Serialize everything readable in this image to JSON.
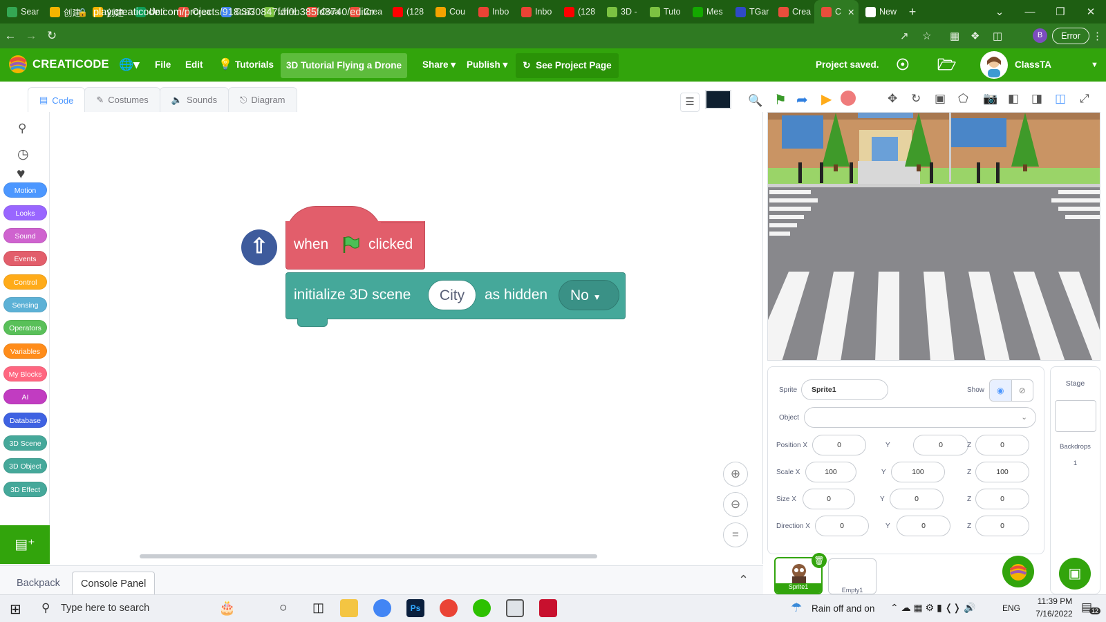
{
  "browser": {
    "tabs": [
      {
        "label": "Sear",
        "color": "#34a853"
      },
      {
        "label": "创建",
        "color": "#f4b400"
      },
      {
        "label": "创建",
        "color": "#f4b400"
      },
      {
        "label": "Unti",
        "color": "#0f9d58"
      },
      {
        "label": "Crea",
        "color": "#e94e3c"
      },
      {
        "label": "CST/",
        "color": "#4285f4"
      },
      {
        "label": "Unre",
        "color": "#7cc242"
      },
      {
        "label": "Crea",
        "color": "#e94e3c"
      },
      {
        "label": "Crea",
        "color": "#e94e3c"
      },
      {
        "label": "(128",
        "color": "#ff0000"
      },
      {
        "label": "Cou",
        "color": "#f4a300"
      },
      {
        "label": "Inbo",
        "color": "#ea4335"
      },
      {
        "label": "Inbo",
        "color": "#ea4335"
      },
      {
        "label": "(128",
        "color": "#ff0000"
      },
      {
        "label": "3D -",
        "color": "#7cc242"
      },
      {
        "label": "Tuto",
        "color": "#7cc242"
      },
      {
        "label": "Mes",
        "color": "#14a800"
      },
      {
        "label": "TGar",
        "color": "#2f4ac8"
      },
      {
        "label": "Crea",
        "color": "#e94e3c"
      },
      {
        "label": "C",
        "color": "#e94e3c",
        "active": true
      },
      {
        "label": "New",
        "color": "#ffffff"
      }
    ],
    "url_domain": "play.creaticode.com",
    "url_path": "/projects/918ca30847fdf0b385fd8740/editor",
    "error_label": "Error",
    "profile_initial": "B"
  },
  "menubar": {
    "brand": "CREATICODE",
    "file": "File",
    "edit": "Edit",
    "tutorials": "Tutorials",
    "project_title": "3D Tutorial Flying a Drone",
    "share": "Share",
    "publish": "Publish",
    "see_project": "See Project Page",
    "save_status": "Project saved.",
    "username": "ClassTA"
  },
  "editor_tabs": [
    "Code",
    "Costumes",
    "Sounds",
    "Diagram"
  ],
  "categories": [
    {
      "label": "Motion",
      "color": "#4c97ff"
    },
    {
      "label": "Looks",
      "color": "#9966ff"
    },
    {
      "label": "Sound",
      "color": "#cf63cf"
    },
    {
      "label": "Events",
      "color": "#e25e6b"
    },
    {
      "label": "Control",
      "color": "#ffab19"
    },
    {
      "label": "Sensing",
      "color": "#5cb1d6"
    },
    {
      "label": "Operators",
      "color": "#59c059"
    },
    {
      "label": "Variables",
      "color": "#ff8c1a"
    },
    {
      "label": "My Blocks",
      "color": "#ff6680"
    },
    {
      "label": "AI",
      "color": "#c13cc1"
    },
    {
      "label": "Database",
      "color": "#3f62e2"
    },
    {
      "label": "3D Scene",
      "color": "#45a89a"
    },
    {
      "label": "3D Object",
      "color": "#45a89a"
    },
    {
      "label": "3D Effect",
      "color": "#45a89a"
    }
  ],
  "blocks": {
    "hat_when": "when",
    "hat_clicked": "clicked",
    "cmd_text1": "initialize 3D scene",
    "cmd_scene": "City",
    "cmd_text2": "as hidden",
    "cmd_hidden": "No"
  },
  "sprite": {
    "sprite_label": "Sprite",
    "sprite_name": "Sprite1",
    "show_label": "Show",
    "object_label": "Object",
    "position_label": "Position X",
    "scale_label": "Scale X",
    "size_label": "Size X",
    "direction_label": "Direction X",
    "y_label": "Y",
    "z_label": "Z",
    "position": [
      "0",
      "0",
      "0"
    ],
    "scale": [
      "100",
      "100",
      "100"
    ],
    "size": [
      "0",
      "0",
      "0"
    ],
    "direction": [
      "0",
      "0",
      "0"
    ],
    "sprite_thumb_label": "Sprite1",
    "empty_thumb_label": "Empty1"
  },
  "stage_panel": {
    "title": "Stage",
    "backdrops_label": "Backdrops",
    "backdrops_count": "1"
  },
  "bottom_tabs": {
    "backpack": "Backpack",
    "console": "Console Panel"
  },
  "taskbar": {
    "search_placeholder": "Type here to search",
    "weather": "Rain off and on",
    "lang": "ENG",
    "time": "11:39 PM",
    "date": "7/16/2022",
    "notif_count": "12"
  }
}
